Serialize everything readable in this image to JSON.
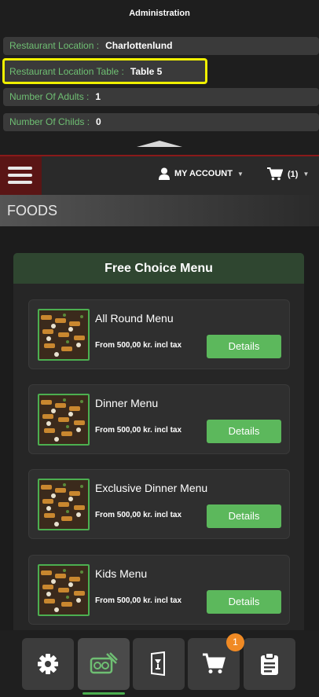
{
  "admin": {
    "title": "Administration",
    "rows": [
      {
        "label": "Restaurant Location :",
        "value": "Charlottenlund"
      },
      {
        "label": "Restaurant Location Table :",
        "value": "Table 5"
      },
      {
        "label": "Number Of Adults :",
        "value": "1"
      },
      {
        "label": "Number Of Childs :",
        "value": "0"
      }
    ],
    "highlight_color": "#f0f000"
  },
  "nav": {
    "account_label": "MY ACCOUNT",
    "cart_count": "(1)"
  },
  "section": {
    "title": "FOODS"
  },
  "menu": {
    "title": "Free Choice Menu",
    "items": [
      {
        "name": "All Round Menu",
        "price": "From 500,00 kr. incl tax",
        "button": "Details"
      },
      {
        "name": "Dinner Menu",
        "price": "From 500,00 kr. incl tax",
        "button": "Details"
      },
      {
        "name": "Exclusive Dinner Menu",
        "price": "From 500,00 kr. incl tax",
        "button": "Details"
      },
      {
        "name": "Kids Menu",
        "price": "From 500,00 kr. incl tax",
        "button": "Details"
      }
    ]
  },
  "bottom_nav": {
    "items": [
      "gear-icon",
      "food-menu-icon",
      "drinks-menu-icon",
      "cart-icon",
      "clipboard-icon"
    ],
    "active": "food-menu-icon",
    "cart_badge": "1"
  },
  "colors": {
    "accent_green": "#5cb85c",
    "header_green": "#2f4630",
    "badge_orange": "#f08a24",
    "hamburger_red": "#5a1515"
  }
}
